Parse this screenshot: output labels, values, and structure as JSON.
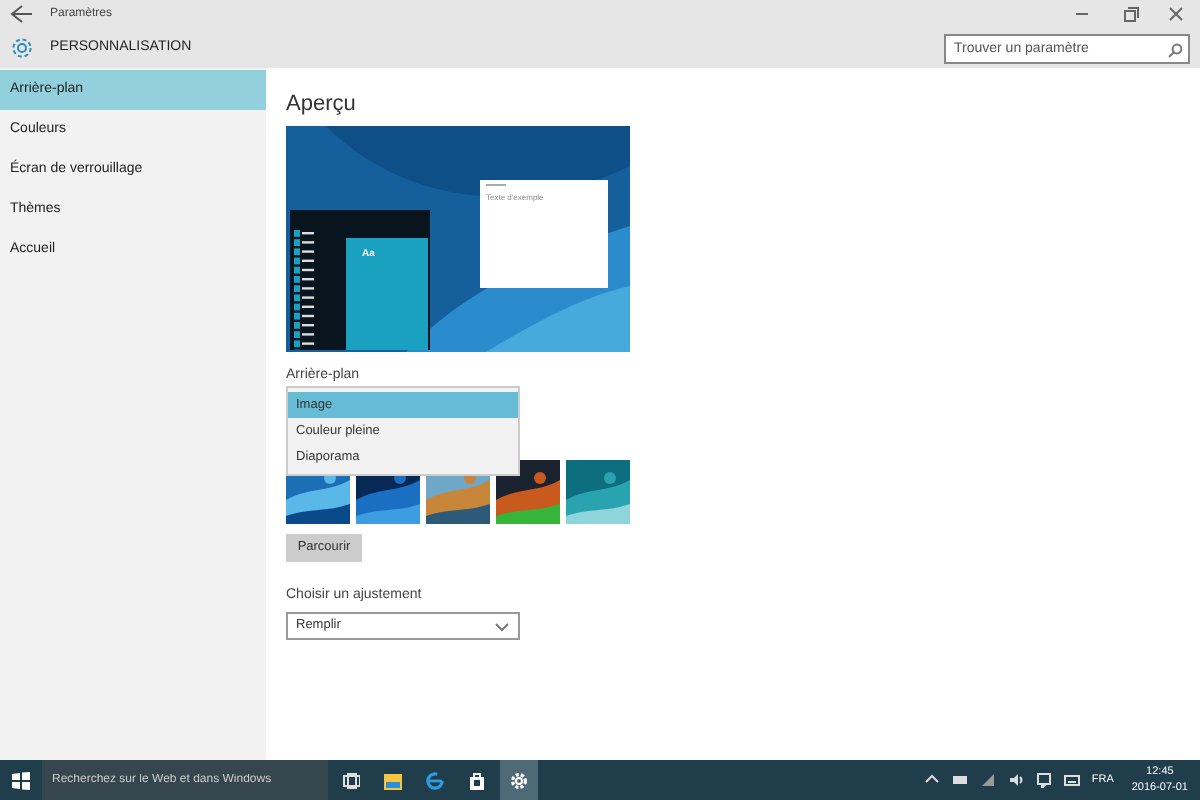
{
  "window": {
    "title": "Paramètres"
  },
  "header": {
    "title": "PERSONNALISATION"
  },
  "search": {
    "placeholder": "Trouver un paramètre"
  },
  "sidebar": {
    "items": [
      {
        "label": "Arrière-plan",
        "selected": true
      },
      {
        "label": "Couleurs",
        "selected": false
      },
      {
        "label": "Écran de verrouillage",
        "selected": false
      },
      {
        "label": "Thèmes",
        "selected": false
      },
      {
        "label": "Accueil",
        "selected": false
      }
    ]
  },
  "preview": {
    "heading": "Aperçu",
    "sample_text": "Texte d'exemple",
    "tile_label": "Aa"
  },
  "background": {
    "label": "Arrière-plan",
    "options": [
      {
        "label": "Image",
        "selected": true
      },
      {
        "label": "Couleur pleine",
        "selected": false
      },
      {
        "label": "Diaporama",
        "selected": false
      }
    ]
  },
  "browse_button": "Parcourir",
  "fit": {
    "label": "Choisir un ajustement",
    "value": "Remplir"
  },
  "taskbar": {
    "search_placeholder": "Recherchez sur le Web et dans Windows",
    "language": "FRA",
    "time": "12:45",
    "date": "2016-07-01"
  }
}
